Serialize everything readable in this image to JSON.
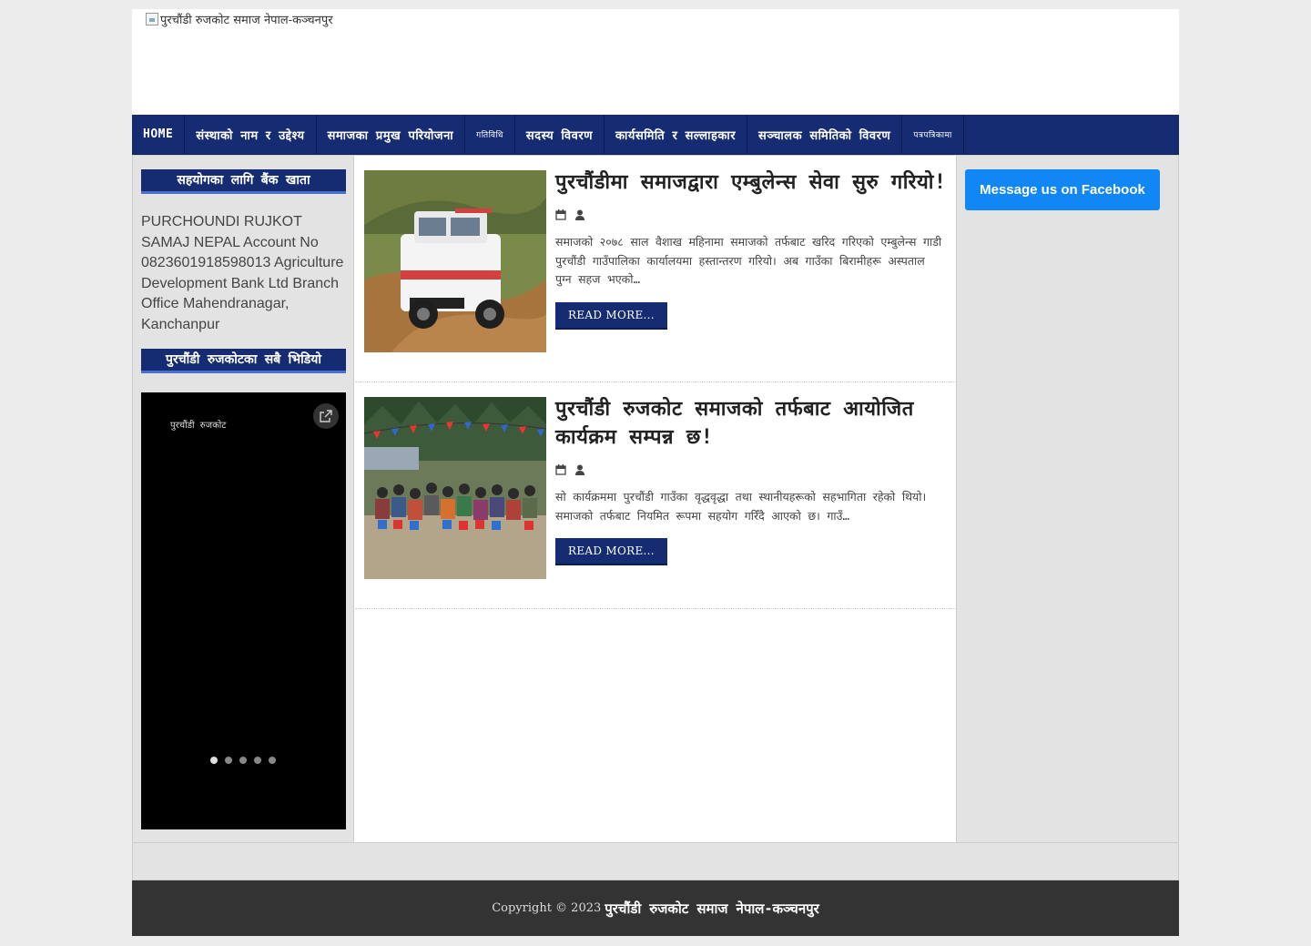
{
  "header": {
    "logo_alt": "पुरचौंडी रुजकोट समाज नेपाल-कञ्चनपुर"
  },
  "nav": {
    "items": [
      {
        "label": "HOME",
        "small": false
      },
      {
        "label": "संस्थाको नाम र उद्देश्य",
        "small": false
      },
      {
        "label": "समाजका प्रमुख परियोजना",
        "small": false
      },
      {
        "label": "गतिविधि",
        "small": true
      },
      {
        "label": "सदस्य विवरण",
        "small": false
      },
      {
        "label": "कार्यसमिति र सल्लाहकार",
        "small": false
      },
      {
        "label": "सञ्चालक समितिको विवरण",
        "small": false
      },
      {
        "label": "पत्रपत्रिकामा",
        "small": true
      }
    ]
  },
  "sidebar_left": {
    "widget1_title": "सहयोगका लागि बैंक खाता",
    "widget1_text": "PURCHOUNDI RUJKOT SAMAJ NEPAL Account No 0823601918598013 Agriculture Development Bank Ltd Branch Office Mahendranagar, Kanchanpur",
    "widget2_title": "पुरचौंडी रुजकोटका सबै भिडियो",
    "video_caption": "पुरचौंडी रुजकोट",
    "video_slides": 5,
    "video_active_slide": 1
  },
  "posts": [
    {
      "title": "पुरचौंडीमा समाजद्वारा एम्बुलेन्स सेवा सुरु गरियो!",
      "excerpt": "  समाजको २०७८ साल वैशाख महिनामा समाजको तर्फबाट खरिद गरिएको एम्बुलेन्स गाडी पुरचौंडी गाउँपालिका कार्यालयमा हस्तान्तरण गरियो। अब गाउँका बिरामीहरू अस्पताल पुग्न सहज भएको…",
      "read_more": "READ MORE..."
    },
    {
      "title": "पुरचौंडी रुजकोट समाजको तर्फबाट आयोजित कार्यक्रम सम्पन्न छ!",
      "excerpt": "सो कार्यक्रममा पुरचौंडी गाउँका वृद्धवृद्धा तथा स्थानीयहरूको सहभागिता रहेको थियो। समाजको तर्फबाट नियमित रूपमा सहयोग गरिँदै आएको छ। गाउँ…",
      "read_more": "READ MORE..."
    }
  ],
  "sidebar_right": {
    "fb_button": "Message us on Facebook"
  },
  "footer": {
    "copyright": "Copyright © 2023",
    "site_name": "पुरचौंडी रुजकोट समाज नेपाल-कञ्चनपुर"
  },
  "colors": {
    "nav_bg": "#152c73",
    "facebook_blue": "#1186f5",
    "footer_bg": "#333333"
  }
}
